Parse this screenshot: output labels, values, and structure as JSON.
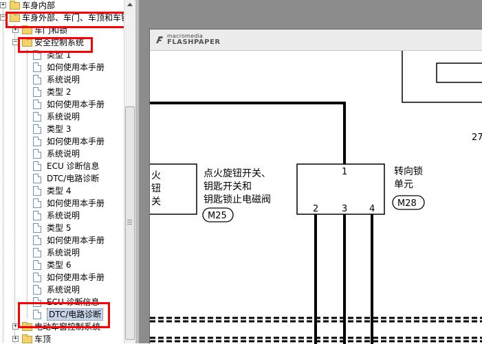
{
  "tree": {
    "items": [
      {
        "label": "车身内部",
        "kind": "folder",
        "level": 0,
        "expander": "+"
      },
      {
        "label": "车身外部、车门、车顶和车锁",
        "kind": "folder",
        "level": 0,
        "expander": "-"
      },
      {
        "label": "车门和锁",
        "kind": "folder",
        "level": 1,
        "expander": "+"
      },
      {
        "label": "安全控制系统",
        "kind": "folder",
        "level": 1,
        "expander": "-"
      },
      {
        "label": "类型 1",
        "kind": "doc",
        "level": 2
      },
      {
        "label": "如何使用本手册",
        "kind": "doc",
        "level": 2
      },
      {
        "label": "系统说明",
        "kind": "doc",
        "level": 2
      },
      {
        "label": "类型 2",
        "kind": "doc",
        "level": 2
      },
      {
        "label": "如何使用本手册",
        "kind": "doc",
        "level": 2
      },
      {
        "label": "系统说明",
        "kind": "doc",
        "level": 2
      },
      {
        "label": "类型 3",
        "kind": "doc",
        "level": 2
      },
      {
        "label": "如何使用本手册",
        "kind": "doc",
        "level": 2
      },
      {
        "label": "系统说明",
        "kind": "doc",
        "level": 2
      },
      {
        "label": "ECU 诊断信息",
        "kind": "doc",
        "level": 2
      },
      {
        "label": "DTC/电路诊断",
        "kind": "doc",
        "level": 2
      },
      {
        "label": "类型 4",
        "kind": "doc",
        "level": 2
      },
      {
        "label": "如何使用本手册",
        "kind": "doc",
        "level": 2
      },
      {
        "label": "系统说明",
        "kind": "doc",
        "level": 2
      },
      {
        "label": "类型 5",
        "kind": "doc",
        "level": 2
      },
      {
        "label": "如何使用本手册",
        "kind": "doc",
        "level": 2
      },
      {
        "label": "系统说明",
        "kind": "doc",
        "level": 2
      },
      {
        "label": "类型 6",
        "kind": "doc",
        "level": 2
      },
      {
        "label": "如何使用本手册",
        "kind": "doc",
        "level": 2
      },
      {
        "label": "系统说明",
        "kind": "doc",
        "level": 2
      },
      {
        "label": "ECU 诊断信息",
        "kind": "doc",
        "level": 2
      },
      {
        "label": "DTC/电路诊断",
        "kind": "doc",
        "level": 2,
        "selected": true
      },
      {
        "label": "电动车窗控制系统",
        "kind": "folder",
        "level": 1,
        "expander": "+"
      },
      {
        "label": "车顶",
        "kind": "folder",
        "level": 1,
        "expander": "+"
      }
    ]
  },
  "viewer": {
    "brand_top": "macromedia",
    "brand_bottom": "FLASHPAPER",
    "diagram": {
      "left_component_lines": [
        "火",
        "钮",
        "关"
      ],
      "ignition_label_lines": [
        "点火旋钮开关、",
        "钥匙开关和",
        "钥匙锁止电磁阀"
      ],
      "ignition_connector": "M25",
      "steering_label_lines": [
        "转向锁",
        "单元"
      ],
      "steering_connector": "M28",
      "pin_top": "1",
      "pins_bottom": [
        "2",
        "3",
        "4"
      ],
      "corner_number": "27"
    }
  },
  "colors": {
    "highlight": "#ff0000",
    "selection": "#c7d5ea",
    "viewer_bg": "#8c8c8c"
  }
}
